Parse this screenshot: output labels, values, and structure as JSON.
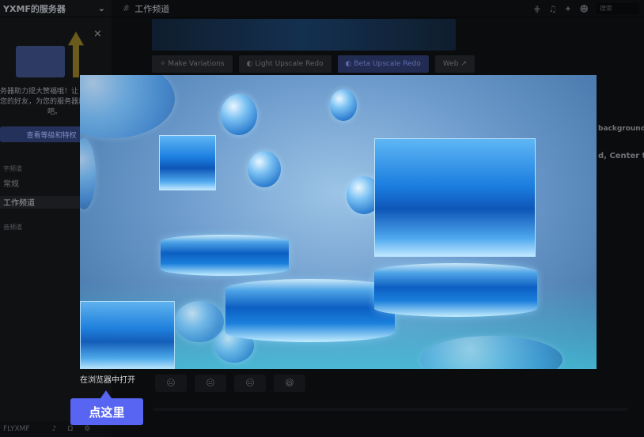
{
  "server": {
    "name": "YXMF的服务器",
    "chevron_icon": "chevron-down-icon"
  },
  "promo": {
    "close_icon": "close-icon",
    "text_lines": [
      "务器助力提大赞福哦！让",
      "您的好友，为您的服务器加",
      "吧。"
    ],
    "button_label": "查看等级和特权"
  },
  "sidebar": {
    "categories": [
      {
        "label": "字频道"
      },
      {
        "label": "音频道"
      }
    ],
    "channels": [
      {
        "label": "常规"
      },
      {
        "label": "工作频道"
      }
    ]
  },
  "user": {
    "name": "FLYXMF"
  },
  "channel": {
    "title": "工作频道"
  },
  "topbar": {
    "search_placeholder": "搜索"
  },
  "message_buttons": [
    {
      "label": "Make Variations",
      "icon": "sparkle-icon"
    },
    {
      "label": "Light Upscale Redo",
      "icon": "refresh-icon"
    },
    {
      "label": "Beta Upscale Redo",
      "icon": "refresh-icon"
    },
    {
      "label": "Web",
      "icon": "external-link-icon"
    }
  ],
  "side_fragments": [
    "background,",
    "d, Center th"
  ],
  "reactions": [
    "😐",
    "😐",
    "😐",
    "😄"
  ],
  "viewer": {
    "open_in_browser": "在浏览器中打开",
    "click_here": "点这里"
  },
  "colors": {
    "blurple": "#5865f2",
    "background": "#0b0c0e"
  }
}
